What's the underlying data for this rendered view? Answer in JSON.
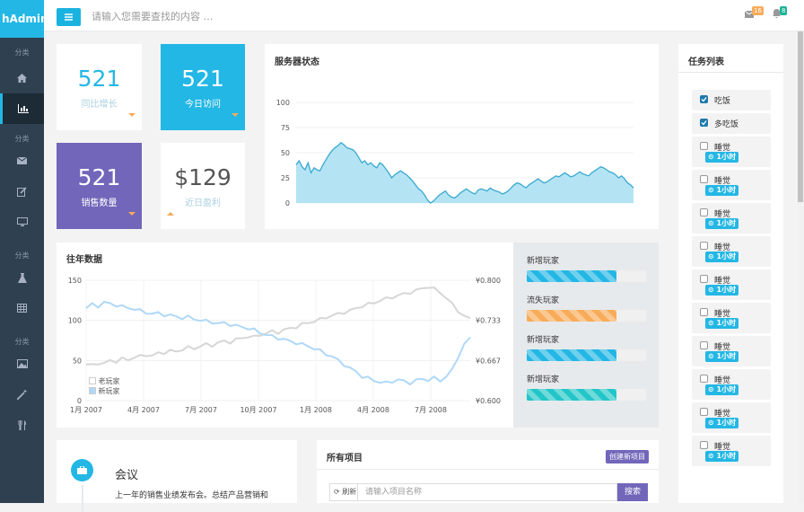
{
  "app": {
    "logo": "hAdmin"
  },
  "sidebar": {
    "sections": [
      "分类",
      "分类",
      "分类",
      "分类"
    ],
    "icons": [
      "home-icon",
      "bar-chart-icon",
      "envelope-icon",
      "edit-icon",
      "desktop-icon",
      "flask-icon",
      "table-icon",
      "picture-icon",
      "magic-icon",
      "cutlery-icon"
    ]
  },
  "topbar": {
    "search_placeholder": "请输入您需要查找的内容 …",
    "mail_badge": "16",
    "bell_badge": "8"
  },
  "stats": [
    {
      "value": "521",
      "label": "同比增长"
    },
    {
      "value": "521",
      "label": "今日访问"
    },
    {
      "value": "521",
      "label": "销售数量"
    },
    {
      "value": "$129",
      "label": "近日盈利"
    }
  ],
  "server": {
    "title": "服务器状态"
  },
  "history": {
    "title": "往年数据",
    "legend": [
      "老玩家",
      "新玩家"
    ]
  },
  "player": {
    "items": [
      {
        "label": "新增玩家",
        "value": 75,
        "color": "#23b7e5"
      },
      {
        "label": "流失玩家",
        "value": 75,
        "color": "#f8ac59"
      },
      {
        "label": "新增玩家",
        "value": 75,
        "color": "#23b7e5"
      },
      {
        "label": "新增玩家",
        "value": 75,
        "color": "#23c6c8"
      }
    ]
  },
  "meeting": {
    "title": "会议",
    "text": "上一年的销售业绩发布会。总结产品营销和"
  },
  "projects": {
    "title": "所有项目",
    "create_label": "创建新项目",
    "refresh_label": "刷新",
    "search_placeholder": "请输入项目名称",
    "search_button": "搜索"
  },
  "tasks": {
    "title": "任务列表",
    "items": [
      {
        "text": "吃饭",
        "checked": true,
        "tag": ""
      },
      {
        "text": "多吃饭",
        "checked": true,
        "tag": ""
      },
      {
        "text": "睡觉",
        "checked": false,
        "tag": "1小时"
      },
      {
        "text": "睡觉",
        "checked": false,
        "tag": "1小时"
      },
      {
        "text": "睡觉",
        "checked": false,
        "tag": "1小时"
      },
      {
        "text": "睡觉",
        "checked": false,
        "tag": "1小时"
      },
      {
        "text": "睡觉",
        "checked": false,
        "tag": "1小时"
      },
      {
        "text": "睡觉",
        "checked": false,
        "tag": "1小时"
      },
      {
        "text": "睡觉",
        "checked": false,
        "tag": "1小时"
      },
      {
        "text": "睡觉",
        "checked": false,
        "tag": "1小时"
      },
      {
        "text": "睡觉",
        "checked": false,
        "tag": "1小时"
      },
      {
        "text": "睡觉",
        "checked": false,
        "tag": "1小时"
      }
    ]
  },
  "chart_data": [
    {
      "type": "area",
      "title": "服务器状态",
      "ylim": [
        0,
        100
      ],
      "yticks": [
        "0",
        "25",
        "50",
        "75",
        "100"
      ],
      "series": [
        {
          "values": [
            38,
            42,
            36,
            33,
            40,
            30,
            35,
            33,
            32,
            38,
            43,
            48,
            52,
            55,
            57,
            60,
            58,
            55,
            54,
            53,
            50,
            45,
            40,
            42,
            38,
            40,
            37,
            35,
            40,
            38,
            34,
            30,
            25,
            28,
            30,
            32,
            30,
            28,
            25,
            22,
            18,
            14,
            12,
            8,
            3,
            0,
            2,
            5,
            8,
            10,
            12,
            8,
            6,
            5,
            7,
            10,
            12,
            14,
            12,
            10,
            9,
            13,
            14,
            13,
            12,
            15,
            13,
            12,
            11,
            9,
            10,
            12,
            15,
            18,
            20,
            19,
            17,
            15,
            18,
            20,
            22,
            24,
            22,
            20,
            21,
            23,
            25,
            27,
            26,
            28,
            30,
            28,
            26,
            27,
            29,
            31,
            29,
            28,
            27,
            30,
            32,
            34,
            36,
            35,
            33,
            31,
            30,
            28,
            25,
            27,
            24,
            20,
            18,
            15
          ]
        }
      ]
    },
    {
      "type": "line",
      "title": "往年数据",
      "ylim": [
        0,
        150
      ],
      "yticks": [
        "0",
        "50",
        "100",
        "150"
      ],
      "y2ticks": [
        "¥0.600",
        "¥0.667",
        "¥0.733",
        "¥0.800"
      ],
      "xticks": [
        "1月 2007",
        "4月 2007",
        "7月 2007",
        "10月 2007",
        "1月 2008",
        "4月 2008",
        "7月 2008"
      ],
      "series": [
        {
          "name": "老玩家",
          "color": "#d6d6d6",
          "values": [
            45,
            44,
            47,
            46,
            50,
            49,
            52,
            51,
            54,
            55,
            57,
            56,
            59,
            60,
            62,
            61,
            64,
            66,
            65,
            68,
            70,
            69,
            72,
            74,
            73,
            76,
            78,
            80,
            79,
            82,
            84,
            86,
            85,
            88,
            90,
            92,
            95,
            97,
            99,
            101,
            104,
            106,
            108,
            110,
            112,
            115,
            118,
            120,
            122,
            125,
            127,
            129,
            131,
            133,
            135,
            137,
            140,
            142,
            139,
            135,
            128,
            120,
            112,
            105,
            102
          ]
        },
        {
          "name": "新玩家",
          "color": "#afd8f8",
          "values": [
            115,
            120,
            118,
            122,
            121,
            119,
            117,
            116,
            114,
            112,
            110,
            108,
            109,
            107,
            106,
            105,
            103,
            104,
            102,
            100,
            99,
            98,
            96,
            97,
            95,
            93,
            92,
            90,
            88,
            85,
            82,
            80,
            78,
            76,
            74,
            72,
            70,
            68,
            65,
            62,
            58,
            55,
            50,
            45,
            40,
            36,
            30,
            28,
            25,
            23,
            22,
            24,
            26,
            24,
            22,
            25,
            27,
            26,
            28,
            25,
            30,
            38,
            55,
            70,
            78
          ]
        }
      ]
    }
  ]
}
